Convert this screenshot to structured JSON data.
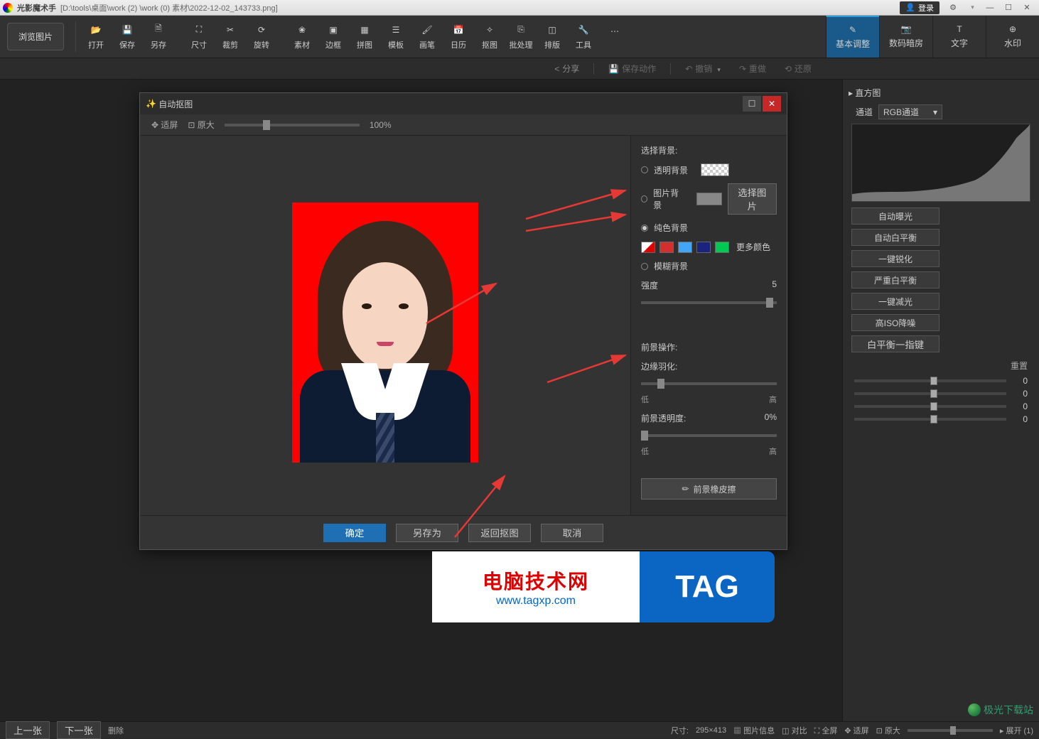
{
  "title": {
    "app": "光影魔术手",
    "path": "[D:\\tools\\桌面\\work (2) \\work (0) 素材\\2022-12-02_143733.png]"
  },
  "titlebar": {
    "login": "登录"
  },
  "toolbar": {
    "browse": "浏览图片",
    "items": [
      "打开",
      "保存",
      "另存",
      "尺寸",
      "裁剪",
      "旋转",
      "素材",
      "边框",
      "拼图",
      "模板",
      "画笔",
      "日历",
      "抠图",
      "批处理",
      "排版",
      "工具"
    ]
  },
  "rightTabs": [
    "基本调整",
    "数码暗房",
    "文字",
    "水印"
  ],
  "subtoolbar": {
    "share": "分享",
    "saveAction": "保存动作",
    "undo": "撤销",
    "redo": "重做",
    "restore": "还原"
  },
  "sidepanel": {
    "histogram": "直方图",
    "channel": "通道",
    "channelValue": "RGB通道",
    "buttons": [
      "自动曝光",
      "自动白平衡",
      "一键锐化",
      "严重白平衡",
      "一键减光",
      "高ISO降噪"
    ],
    "wb": "白平衡一指键",
    "reset": "重置",
    "sliders": [
      {
        "v": "0"
      },
      {
        "v": "0"
      },
      {
        "v": "0"
      },
      {
        "v": "0"
      }
    ]
  },
  "dialog": {
    "title": "自动抠图",
    "fit": "适屏",
    "orig": "原大",
    "zoom": "100%",
    "side": {
      "selectBg": "选择背景:",
      "transparent": "透明背景",
      "imageBg": "图片背景",
      "chooseImg": "选择图片",
      "solidBg": "纯色背景",
      "moreColor": "更多颜色",
      "blurBg": "模糊背景",
      "strength": "强度",
      "strengthVal": "5",
      "fgOps": "前景操作:",
      "feather": "边缘羽化:",
      "low": "低",
      "high": "高",
      "fgOpacity": "前景透明度:",
      "opv": "0%",
      "eraser": "前景橡皮擦",
      "colors": [
        "#ffffff",
        "#d32f2f",
        "#42a5f5",
        "#1a237e",
        "#00c853"
      ]
    },
    "footer": {
      "ok": "确定",
      "saveAs": "另存为",
      "back": "返回抠图",
      "cancel": "取消"
    }
  },
  "status": {
    "prev": "上一张",
    "next": "下一张",
    "delete": "删除",
    "size": "尺寸:",
    "sizeVal": "295×413",
    "info": "图片信息",
    "compare": "对比",
    "full": "全屏",
    "fit": "适屏",
    "orig": "原大",
    "expand": "展开 (1)"
  },
  "watermark": {
    "l1": "电脑技术网",
    "l2": "www.tagxp.com",
    "tag": "TAG",
    "corner": "极光下载站"
  }
}
